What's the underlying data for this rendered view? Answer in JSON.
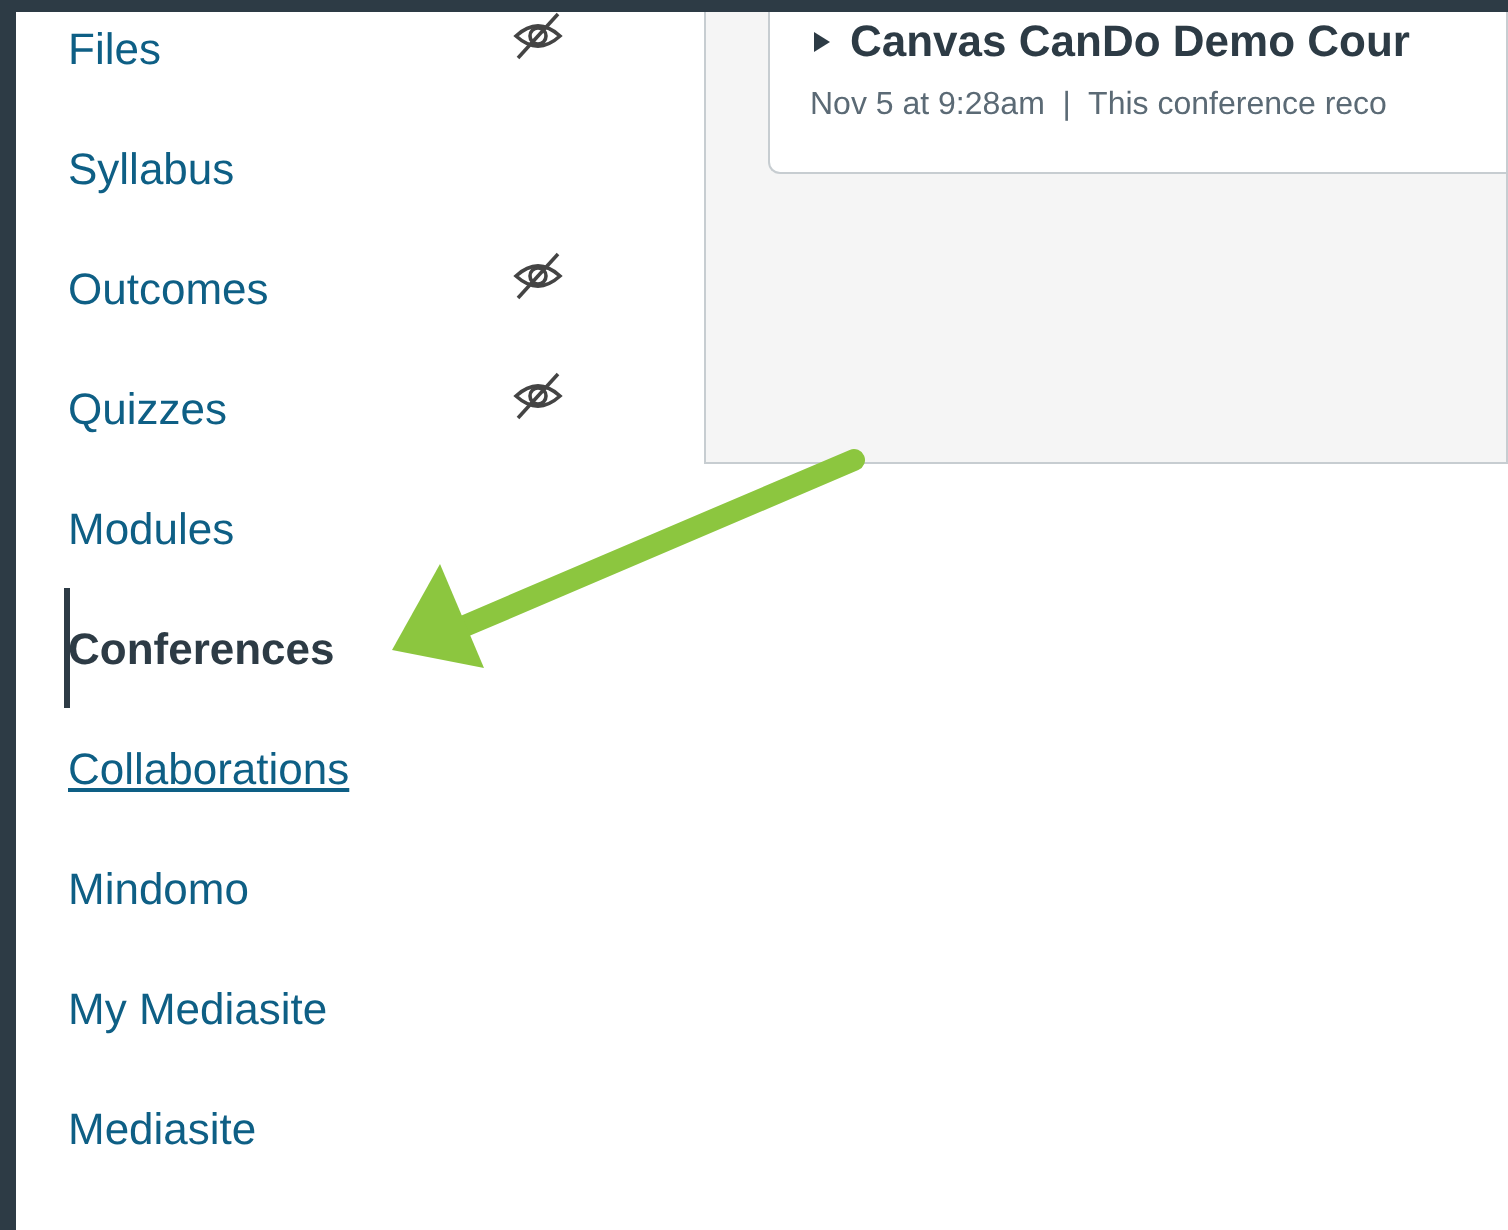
{
  "course_nav": {
    "items": [
      {
        "label": "Files",
        "hidden": true,
        "selected": false,
        "hovered": false
      },
      {
        "label": "Syllabus",
        "hidden": false,
        "selected": false,
        "hovered": false
      },
      {
        "label": "Outcomes",
        "hidden": true,
        "selected": false,
        "hovered": false
      },
      {
        "label": "Quizzes",
        "hidden": true,
        "selected": false,
        "hovered": false
      },
      {
        "label": "Modules",
        "hidden": false,
        "selected": false,
        "hovered": false
      },
      {
        "label": "Conferences",
        "hidden": false,
        "selected": true,
        "hovered": false
      },
      {
        "label": "Collaborations",
        "hidden": false,
        "selected": false,
        "hovered": true
      },
      {
        "label": "Mindomo",
        "hidden": false,
        "selected": false,
        "hovered": false
      },
      {
        "label": "My Mediasite",
        "hidden": false,
        "selected": false,
        "hovered": false
      },
      {
        "label": "Mediasite",
        "hidden": false,
        "selected": false,
        "hovered": false
      }
    ]
  },
  "conference": {
    "expanded": false,
    "title": "Canvas CanDo Demo Cour",
    "meta": "Nov 5 at 9:28am  |  This conference reco"
  }
}
